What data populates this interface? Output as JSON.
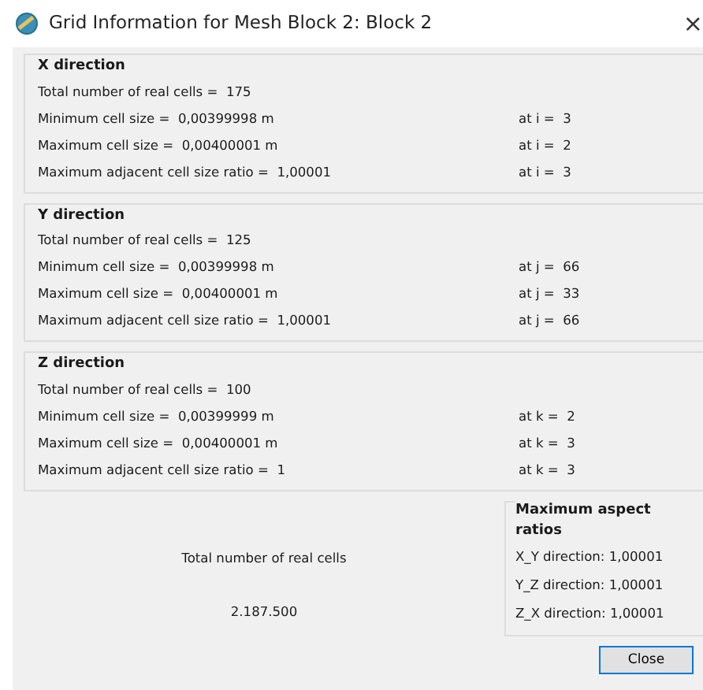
{
  "window": {
    "title": "Grid Information for Mesh Block 2: Block 2",
    "close": "×"
  },
  "sections": [
    {
      "title": "X direction",
      "rows": [
        {
          "text": "Total number of real cells =  175"
        },
        {
          "text": "Minimum cell size =  0,00399998 m",
          "at": "at i =  3"
        },
        {
          "text": "Maximum cell size =  0,00400001 m",
          "at": "at i =  2"
        },
        {
          "text": "Maximum adjacent cell size ratio =  1,00001",
          "at": "at i =  3"
        }
      ]
    },
    {
      "title": "Y direction",
      "rows": [
        {
          "text": "Total number of real cells =  125"
        },
        {
          "text": "Minimum cell size =  0,00399998 m",
          "at": "at j =  66"
        },
        {
          "text": "Maximum cell size =  0,00400001 m",
          "at": "at j =  33"
        },
        {
          "text": "Maximum adjacent cell size ratio =  1,00001",
          "at": "at j =  66"
        }
      ]
    },
    {
      "title": "Z direction",
      "rows": [
        {
          "text": "Total number of real cells =  100"
        },
        {
          "text": "Minimum cell size =  0,00399999 m",
          "at": "at k =  2"
        },
        {
          "text": "Maximum cell size =  0,00400001 m",
          "at": "at k =  3"
        },
        {
          "text": "Maximum adjacent cell size ratio =  1",
          "at": "at k =  3"
        }
      ]
    }
  ],
  "total": {
    "label": "Total number of real cells",
    "value": "2.187.500"
  },
  "aspect": {
    "title": "Maximum aspect ratios",
    "lines": [
      "X_Y direction: 1,00001",
      "Y_Z direction: 1,00001",
      "Z_X direction: 1,00001"
    ]
  },
  "buttons": [
    "Close"
  ]
}
